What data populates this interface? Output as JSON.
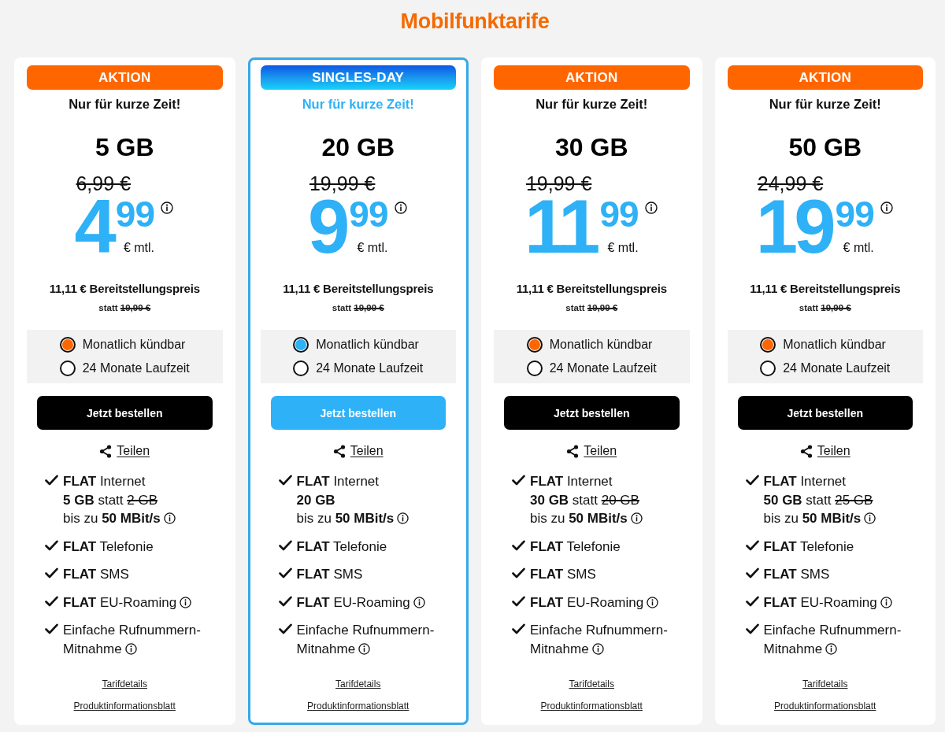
{
  "title": "Mobilfunktarife",
  "cards": [
    {
      "featured": false,
      "badge": {
        "kind": "aktion",
        "label": "AKTION"
      },
      "tagline": "Nur für kurze Zeit!",
      "volume": "5 GB",
      "old_price": "6,99 €",
      "price": {
        "euros": "4",
        "cents": "99",
        "unit": "€ mtl.",
        "info": true
      },
      "setup_fee": "11,11 € Bereitstellungspreis",
      "setup_compare": "statt",
      "setup_old_price": "19,99 €",
      "options": [
        {
          "label": "Monatlich kündbar",
          "selected": true
        },
        {
          "label": "24 Monate Laufzeit",
          "selected": false
        }
      ],
      "order_button": "Jetzt bestellen",
      "share_link": "Teilen",
      "features": [
        {
          "kind": "internet",
          "text": "**FLAT** Internet",
          "volume": "5 GB",
          "compare": "statt",
          "old_volume": "2 GB",
          "speed": "bis zu **50 MBit/s**",
          "info": true
        },
        {
          "kind": "plain",
          "lines": [
            "**FLAT** Telefonie"
          ],
          "info": false
        },
        {
          "kind": "plain",
          "lines": [
            "**FLAT** SMS"
          ],
          "info": false
        },
        {
          "kind": "plain",
          "lines": [
            "**FLAT** EU-Roaming"
          ],
          "info": true
        },
        {
          "kind": "plain",
          "lines": [
            "Einfache Rufnummern-",
            "Mitnahme"
          ],
          "info": true
        }
      ],
      "links": [
        "Tarifdetails",
        "Produktinformationsblatt"
      ]
    },
    {
      "featured": true,
      "badge": {
        "kind": "singles_day",
        "label": "SINGLES-DAY"
      },
      "tagline": "Nur für kurze Zeit!",
      "volume": "20 GB",
      "old_price": "19,99 €",
      "price": {
        "euros": "9",
        "cents": "99",
        "unit": "€ mtl.",
        "info": true
      },
      "setup_fee": "11,11 € Bereitstellungspreis",
      "setup_compare": "statt",
      "setup_old_price": "19,99 €",
      "options": [
        {
          "label": "Monatlich kündbar",
          "selected": true
        },
        {
          "label": "24 Monate Laufzeit",
          "selected": false
        }
      ],
      "order_button": "Jetzt bestellen",
      "share_link": "Teilen",
      "features": [
        {
          "kind": "internet",
          "text": "**FLAT** Internet",
          "volume": "20 GB",
          "speed": "bis zu **50 MBit/s**",
          "info": true
        },
        {
          "kind": "plain",
          "lines": [
            "**FLAT** Telefonie"
          ],
          "info": false
        },
        {
          "kind": "plain",
          "lines": [
            "**FLAT** SMS"
          ],
          "info": false
        },
        {
          "kind": "plain",
          "lines": [
            "**FLAT** EU-Roaming"
          ],
          "info": true
        },
        {
          "kind": "plain",
          "lines": [
            "Einfache Rufnummern-",
            "Mitnahme"
          ],
          "info": true
        }
      ],
      "links": [
        "Tarifdetails",
        "Produktinformationsblatt"
      ]
    },
    {
      "featured": false,
      "badge": {
        "kind": "aktion",
        "label": "AKTION"
      },
      "tagline": "Nur für kurze Zeit!",
      "volume": "30 GB",
      "old_price": "19,99 €",
      "price": {
        "euros": "11",
        "cents": "99",
        "unit": "€ mtl.",
        "info": true
      },
      "setup_fee": "11,11 € Bereitstellungspreis",
      "setup_compare": "statt",
      "setup_old_price": "19,99 €",
      "options": [
        {
          "label": "Monatlich kündbar",
          "selected": true
        },
        {
          "label": "24 Monate Laufzeit",
          "selected": false
        }
      ],
      "order_button": "Jetzt bestellen",
      "share_link": "Teilen",
      "features": [
        {
          "kind": "internet",
          "text": "**FLAT** Internet",
          "volume": "30 GB",
          "compare": "statt",
          "old_volume": "20 GB",
          "speed": "bis zu **50 MBit/s**",
          "info": true
        },
        {
          "kind": "plain",
          "lines": [
            "**FLAT** Telefonie"
          ],
          "info": false
        },
        {
          "kind": "plain",
          "lines": [
            "**FLAT** SMS"
          ],
          "info": false
        },
        {
          "kind": "plain",
          "lines": [
            "**FLAT** EU-Roaming"
          ],
          "info": true
        },
        {
          "kind": "plain",
          "lines": [
            "Einfache Rufnummern-",
            "Mitnahme"
          ],
          "info": true
        }
      ],
      "links": [
        "Tarifdetails",
        "Produktinformationsblatt"
      ]
    },
    {
      "featured": false,
      "badge": {
        "kind": "aktion",
        "label": "AKTION"
      },
      "tagline": "Nur für kurze Zeit!",
      "volume": "50 GB",
      "old_price": "24,99 €",
      "price": {
        "euros": "19",
        "cents": "99",
        "unit": "€ mtl.",
        "info": true
      },
      "setup_fee": "11,11 € Bereitstellungspreis",
      "setup_compare": "statt",
      "setup_old_price": "19,99 €",
      "options": [
        {
          "label": "Monatlich kündbar",
          "selected": true
        },
        {
          "label": "24 Monate Laufzeit",
          "selected": false
        }
      ],
      "order_button": "Jetzt bestellen",
      "share_link": "Teilen",
      "features": [
        {
          "kind": "internet",
          "text": "**FLAT** Internet",
          "volume": "50 GB",
          "compare": "statt",
          "old_volume": "25 GB",
          "speed": "bis zu **50 MBit/s**",
          "info": true
        },
        {
          "kind": "plain",
          "lines": [
            "**FLAT** Telefonie"
          ],
          "info": false
        },
        {
          "kind": "plain",
          "lines": [
            "**FLAT** SMS"
          ],
          "info": false
        },
        {
          "kind": "plain",
          "lines": [
            "**FLAT** EU-Roaming"
          ],
          "info": true
        },
        {
          "kind": "plain",
          "lines": [
            "Einfache Rufnummern-",
            "Mitnahme"
          ],
          "info": true
        }
      ],
      "links": [
        "Tarifdetails",
        "Produktinformationsblatt"
      ]
    }
  ]
}
